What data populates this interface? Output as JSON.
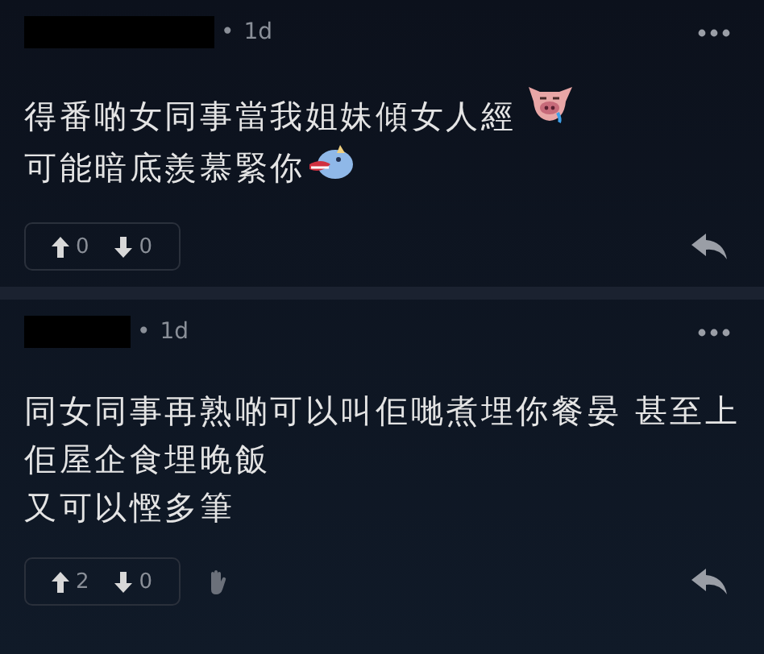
{
  "comments": [
    {
      "separator": "•",
      "time": "1d",
      "lines": [
        {
          "text": "得番啲女同事當我姐妹傾女人經",
          "kind": "pig"
        },
        {
          "text": "可能暗底羨慕緊你",
          "kind": "bird"
        }
      ],
      "upvotes": "0",
      "downvotes": "0",
      "clap_shown": false
    },
    {
      "separator": "•",
      "time": "1d",
      "lines": [
        {
          "text": "同女同事再熟啲可以叫佢哋煮埋你餐晏 甚至上",
          "kind": "plain"
        },
        {
          "text": "佢屋企食埋晚飯",
          "kind": "plain"
        },
        {
          "text": "又可以慳多筆",
          "kind": "plain"
        }
      ],
      "upvotes": "2",
      "downvotes": "0",
      "clap_shown": true
    }
  ]
}
